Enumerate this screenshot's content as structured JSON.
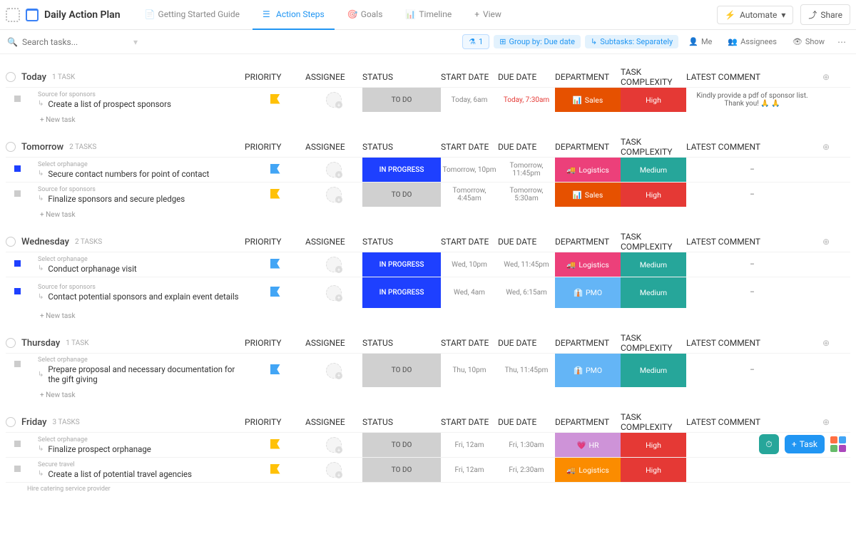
{
  "header": {
    "title": "Daily Action Plan",
    "tabs": [
      {
        "label": "Getting Started Guide"
      },
      {
        "label": "Action Steps"
      },
      {
        "label": "Goals"
      },
      {
        "label": "Timeline"
      },
      {
        "label": "View"
      }
    ],
    "automate": "Automate",
    "share": "Share"
  },
  "filter": {
    "search_placeholder": "Search tasks...",
    "filter_count": "1",
    "groupby": "Group by: Due date",
    "subtasks": "Subtasks: Separately",
    "me": "Me",
    "assignees": "Assignees",
    "show": "Show"
  },
  "cols": {
    "priority": "PRIORITY",
    "assignee": "ASSIGNEE",
    "status": "STATUS",
    "start": "START DATE",
    "due": "DUE DATE",
    "dept": "DEPARTMENT",
    "comp": "TASK COMPLEXITY",
    "comment": "LATEST COMMENT"
  },
  "newtask": "+ New task",
  "groups": [
    {
      "title": "Today",
      "count": "1 TASK",
      "tasks": [
        {
          "parent": "Source for sponsors",
          "title": "Create a list of prospect sponsors",
          "flag": "y",
          "status": "TO DO",
          "st": "todo",
          "start": "Today, 6am",
          "due": "Today, 7:30am",
          "due_red": true,
          "dept": "Sales",
          "dept_cls": "sales",
          "dept_emoji": "📊",
          "comp": "High",
          "comp_cls": "high",
          "comment": "Kindly provide a pdf of sponsor list. Thank you! 🙏 🙏",
          "sq": "g"
        }
      ]
    },
    {
      "title": "Tomorrow",
      "count": "2 TASKS",
      "tasks": [
        {
          "parent": "Select orphanage",
          "title": "Secure contact numbers for point of contact",
          "flag": "b",
          "status": "IN PROGRESS",
          "st": "prog",
          "start": "Tomorrow, 10pm",
          "due": "Tomorrow, 11:45pm",
          "dept": "Logistics",
          "dept_cls": "log",
          "dept_emoji": "🚚",
          "comp": "Medium",
          "comp_cls": "med",
          "comment": "–",
          "sq": "b"
        },
        {
          "parent": "Source for sponsors",
          "title": "Finalize sponsors and secure pledges",
          "flag": "y",
          "status": "TO DO",
          "st": "todo",
          "start": "Tomorrow, 4:45am",
          "due": "Tomorrow, 5:30am",
          "dept": "Sales",
          "dept_cls": "sales",
          "dept_emoji": "📊",
          "comp": "High",
          "comp_cls": "high",
          "comment": "–",
          "sq": "g"
        }
      ]
    },
    {
      "title": "Wednesday",
      "count": "2 TASKS",
      "tasks": [
        {
          "parent": "Select orphanage",
          "title": "Conduct orphanage visit",
          "flag": "b",
          "status": "IN PROGRESS",
          "st": "prog",
          "start": "Wed, 10pm",
          "due": "Wed, 11:45pm",
          "dept": "Logistics",
          "dept_cls": "log",
          "dept_emoji": "🚚",
          "comp": "Medium",
          "comp_cls": "med",
          "comment": "–",
          "sq": "b"
        },
        {
          "parent": "Source for sponsors",
          "title": "Contact potential sponsors and explain event details",
          "flag": "b",
          "status": "IN PROGRESS",
          "st": "prog",
          "start": "Wed, 4am",
          "due": "Wed, 6:15am",
          "dept": "PMO",
          "dept_cls": "pmo",
          "dept_emoji": "👔",
          "comp": "Medium",
          "comp_cls": "med",
          "comment": "–",
          "sq": "b",
          "tall": true
        }
      ]
    },
    {
      "title": "Thursday",
      "count": "1 TASK",
      "tasks": [
        {
          "parent": "Select orphanage",
          "title": "Prepare proposal and necessary documentation for the gift giving",
          "flag": "b",
          "status": "TO DO",
          "st": "todo",
          "start": "Thu, 10pm",
          "due": "Thu, 11:45pm",
          "dept": "PMO",
          "dept_cls": "pmo",
          "dept_emoji": "👔",
          "comp": "Medium",
          "comp_cls": "med",
          "comment": "–",
          "sq": "g",
          "tall": true
        }
      ]
    },
    {
      "title": "Friday",
      "count": "3 TASKS",
      "tasks": [
        {
          "parent": "Select orphanage",
          "title": "Finalize prospect orphanage",
          "flag": "y",
          "status": "TO DO",
          "st": "todo",
          "start": "Fri, 12am",
          "due": "Fri, 1:30am",
          "dept": "HR",
          "dept_cls": "hr",
          "dept_emoji": "💗",
          "comp": "High",
          "comp_cls": "high",
          "comment": "",
          "sq": "g"
        },
        {
          "parent": "Secure travel",
          "title": "Create a list of potential travel agencies",
          "flag": "y",
          "status": "TO DO",
          "st": "todo",
          "start": "Fri, 12am",
          "due": "Fri, 2:30am",
          "dept": "Logistics",
          "dept_cls": "log2",
          "dept_emoji": "🚚",
          "comp": "High",
          "comp_cls": "high",
          "comment": "",
          "sq": "g"
        },
        {
          "parent": "Hire catering service provider",
          "title": "",
          "flag": "",
          "status": "",
          "st": "",
          "start": "",
          "due": "",
          "dept": "",
          "dept_cls": "",
          "comp": "",
          "comp_cls": "",
          "comment": "",
          "sq": "",
          "partial": true
        }
      ]
    }
  ],
  "float": {
    "task": "Task"
  }
}
